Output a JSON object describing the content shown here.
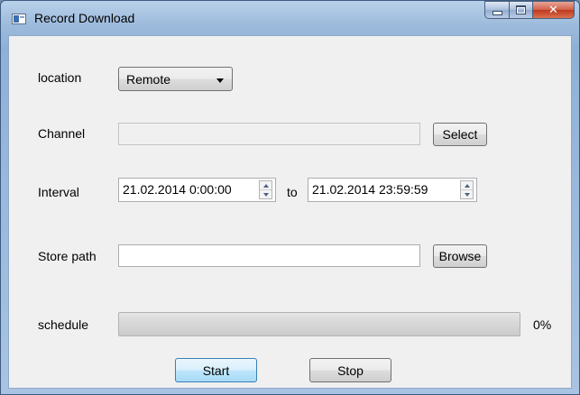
{
  "window": {
    "title": "Record Download"
  },
  "location": {
    "label": "location",
    "selected": "Remote"
  },
  "channel": {
    "label": "Channel",
    "value": "",
    "select_label": "Select"
  },
  "interval": {
    "label": "Interval",
    "from": "21.02.2014 0:00:00",
    "separator": "to",
    "to": "21.02.2014 23:59:59"
  },
  "store_path": {
    "label": "Store path",
    "value": "",
    "browse_label": "Browse"
  },
  "schedule": {
    "label": "schedule",
    "progress_percent": 0,
    "progress_text": "0%"
  },
  "actions": {
    "start_label": "Start",
    "stop_label": "Stop"
  }
}
